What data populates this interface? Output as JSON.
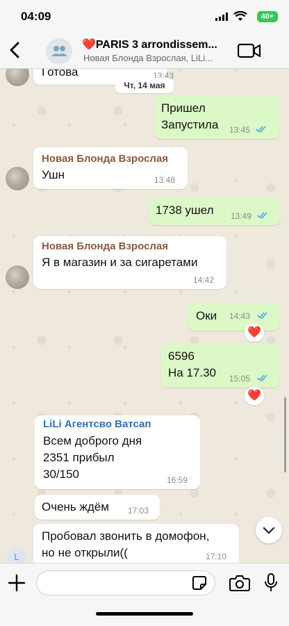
{
  "status": {
    "time": "04:09",
    "battery": "40+"
  },
  "header": {
    "title": "❤️PARIS 3 arrondissem...",
    "subtitle": "Новая Блонда Взрослая, LiLi..."
  },
  "date_separator": "Чт, 14 мая",
  "messages": [
    {
      "text": "Готова",
      "time": "13:43"
    },
    {
      "text": "Пришел\nЗапустила",
      "time": "13:45"
    },
    {
      "sender": "Новая Блонда Взрослая",
      "text": "Ушн",
      "time": "13:48"
    },
    {
      "text": "1738 ушел",
      "time": "13:49"
    },
    {
      "sender": "Новая Блонда Взрослая",
      "text": "Я в магазин и за сигаретами",
      "time": "14:42"
    },
    {
      "text": "Оки",
      "time": "14:43",
      "reaction": "❤️"
    },
    {
      "text": "6596\nНа 17.30",
      "time": "15:05",
      "reaction": "❤️"
    },
    {
      "sender": "LiLi Агентсво Ватсап",
      "text": "Всем доброго дня\n2351 прибыл\n30/150",
      "time": "16:59"
    },
    {
      "text": "Очень ждём",
      "time": "17:03"
    },
    {
      "text": "Пробовал звонить в домофон,\nно не открыли((",
      "time": "17:10",
      "avatar_letter": "L"
    }
  ],
  "colors": {
    "sender_blonda": "#8a5a3c",
    "sender_lili": "#2f6fb4",
    "tick_read": "#3ea6e8",
    "outgoing_bubble": "#dcf8c6"
  },
  "icons": [
    "back-chevron-icon",
    "group-icon",
    "video-call-icon",
    "plus-icon",
    "sticker-icon",
    "camera-icon",
    "mic-icon",
    "chevron-down-icon",
    "heart-reaction-icon"
  ]
}
